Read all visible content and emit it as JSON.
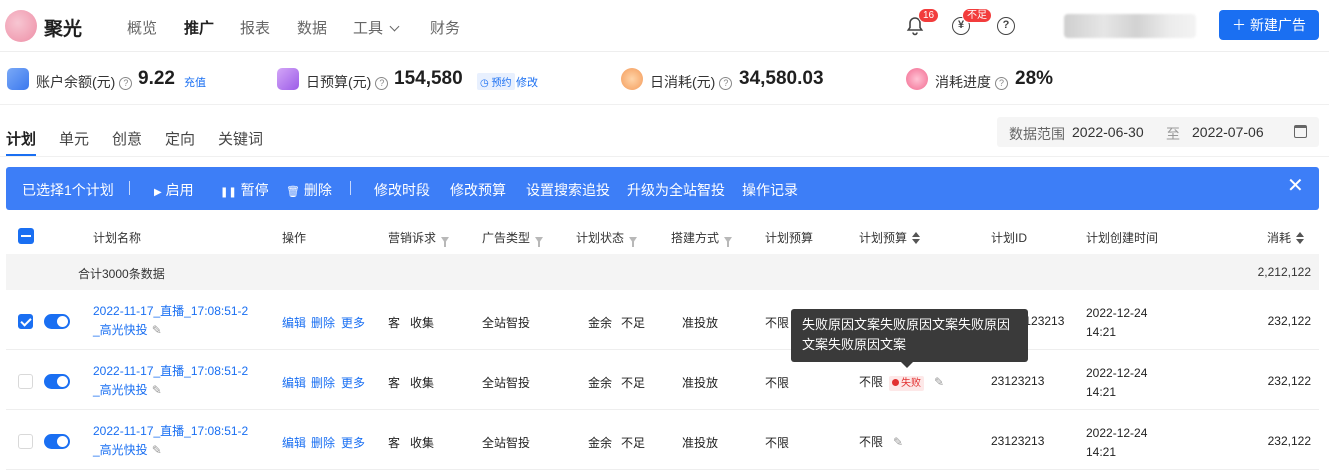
{
  "header": {
    "brand": "聚光",
    "nav": [
      "概览",
      "推广",
      "报表",
      "数据",
      "工具",
      "财务"
    ],
    "active_nav": "推广",
    "bell_count": "16",
    "balance_badge": "不足",
    "new_ad_button": "新建广告"
  },
  "stats": {
    "balance_label": "账户余额(元)",
    "balance_value": "9.22",
    "recharge_link": "充值",
    "daily_budget_label": "日预算(元)",
    "daily_budget_value": "154,580",
    "reserve_tag": "预约",
    "modify_link": "修改",
    "daily_spend_label": "日消耗(元)",
    "daily_spend_value": "34,580.03",
    "progress_label": "消耗进度",
    "progress_value": "28%"
  },
  "tabs": [
    "计划",
    "单元",
    "创意",
    "定向",
    "关键词"
  ],
  "date_range": {
    "label": "数据范围",
    "start": "2022-06-30",
    "to": "至",
    "end": "2022-07-06"
  },
  "action_bar": {
    "selected": "已选择1个计划",
    "enable": "启用",
    "pause": "暂停",
    "delete": "删除",
    "edit_time": "修改时段",
    "edit_budget": "修改预算",
    "search_chase": "设置搜索追投",
    "upgrade": "升级为全站智投",
    "op_log": "操作记录"
  },
  "table": {
    "columns": [
      "计划名称",
      "操作",
      "营销诉求",
      "广告类型",
      "计划状态",
      "搭建方式",
      "计划预算",
      "计划预算",
      "计划ID",
      "计划创建时间",
      "消耗"
    ],
    "summary_label": "合计3000条数据",
    "summary_spend": "2,212,122",
    "ops": {
      "edit": "编辑",
      "delete": "删除",
      "more": "更多"
    },
    "rows": [
      {
        "name1": "2022-11-17_直播_17:08:51-2",
        "name2": "_高光快投",
        "demand1": "客",
        "demand2": "收集",
        "ad_type": "全站智投",
        "status1": "金余",
        "status2": "不足",
        "build": "准投放",
        "budget": "不限",
        "budget2": "",
        "fail_tag": "",
        "plan_id": "23123213",
        "created1": "2022-12-24",
        "created2": "14:21",
        "spend": "232,122",
        "checked": true
      },
      {
        "name1": "2022-11-17_直播_17:08:51-2",
        "name2": "_高光快投",
        "demand1": "客",
        "demand2": "收集",
        "ad_type": "全站智投",
        "status1": "金余",
        "status2": "不足",
        "build": "准投放",
        "budget": "不限",
        "budget2": "不限",
        "fail_tag": "失败",
        "plan_id": "23123213",
        "created1": "2022-12-24",
        "created2": "14:21",
        "spend": "232,122",
        "checked": false
      },
      {
        "name1": "2022-11-17_直播_17:08:51-2",
        "name2": "_高光快投",
        "demand1": "客",
        "demand2": "收集",
        "ad_type": "全站智投",
        "status1": "金余",
        "status2": "不足",
        "build": "准投放",
        "budget": "不限",
        "budget2": "不限",
        "fail_tag": "",
        "plan_id": "23123213",
        "created1": "2022-12-24",
        "created2": "14:21",
        "spend": "232,122",
        "checked": false
      }
    ]
  },
  "tooltip": {
    "line1": "失败原因文案失败原因文案失败原因",
    "line2": "文案失败原因文案"
  },
  "colors": {
    "primary": "#1a6ff2",
    "action_bar": "#3d7ef7",
    "danger": "#e23131"
  }
}
